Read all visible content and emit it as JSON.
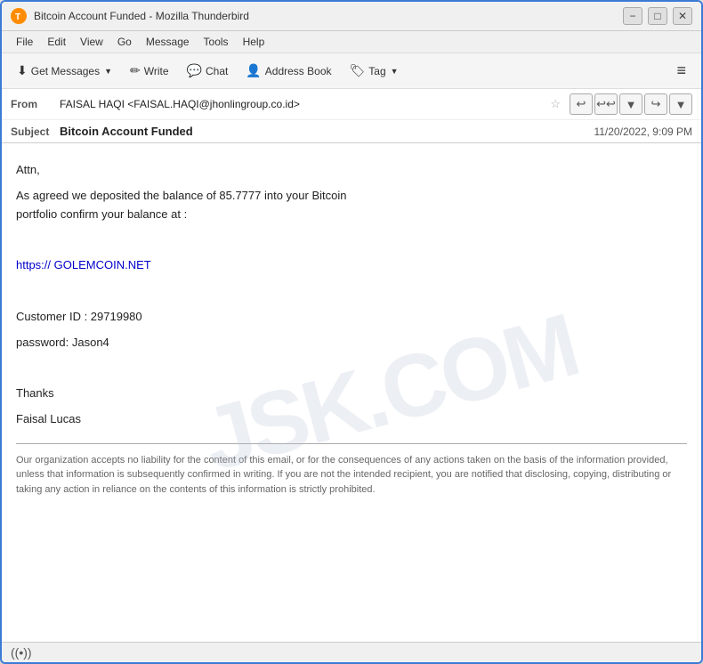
{
  "window": {
    "title": "Bitcoin Account Funded - Mozilla Thunderbird",
    "icon": "🦅"
  },
  "title_controls": {
    "minimize": "−",
    "maximize": "□",
    "close": "✕"
  },
  "menu": {
    "items": [
      "File",
      "Edit",
      "View",
      "Go",
      "Message",
      "Tools",
      "Help"
    ]
  },
  "toolbar": {
    "get_messages_label": "Get Messages",
    "write_label": "Write",
    "chat_label": "Chat",
    "address_book_label": "Address Book",
    "tag_label": "Tag",
    "menu_icon": "≡"
  },
  "email": {
    "from_label": "From",
    "from_value": "FAISAL HAQI <FAISAL.HAQI@jhonlingroup.co.id>",
    "subject_label": "Subject",
    "subject_value": "Bitcoin Account Funded",
    "date_value": "11/20/2022, 9:09 PM",
    "body": {
      "greeting": "Attn,",
      "line1": "As agreed we deposited the balance of 85.7777 into your Bitcoin",
      "line2": "portfolio confirm your balance at :",
      "blank1": "",
      "url": "https:// GOLEMCOIN.NET",
      "blank2": "",
      "customer_id": "Customer ID : 29719980",
      "password": "password:    Jason4",
      "blank3": "",
      "thanks": "Thanks",
      "signature": "Faisal Lucas"
    },
    "disclaimer": "Our organization accepts no liability for the content of this email, or for the consequences of any actions taken on the basis of the information provided, unless that information is subsequently confirmed in writing. If you are not the intended recipient, you are notified that disclosing, copying, distributing or taking any action in reliance on the contents of this information is strictly prohibited."
  },
  "watermark": "JSK.COM",
  "status_bar": {
    "icon": "((•))"
  }
}
